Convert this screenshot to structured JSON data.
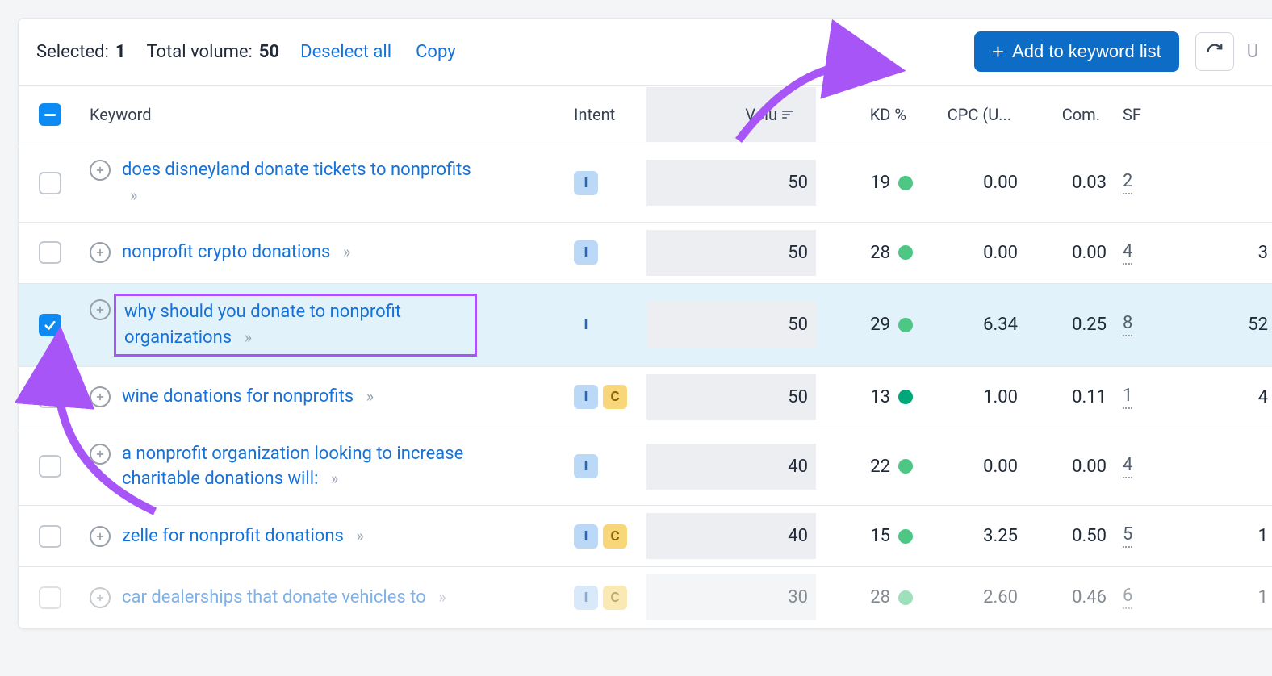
{
  "toolbar": {
    "selected_label": "Selected:",
    "selected_count": "1",
    "total_volume_label": "Total volume:",
    "total_volume": "50",
    "deselect_label": "Deselect all",
    "copy_label": "Copy",
    "add_button_label": "Add to keyword list",
    "update_fragment": "U"
  },
  "columns": {
    "keyword": "Keyword",
    "intent": "Intent",
    "volume": "Volu",
    "kd": "KD %",
    "cpc": "CPC (U...",
    "com": "Com.",
    "sf": "SF"
  },
  "rows": [
    {
      "checked": false,
      "keyword": "does disneyland donate tickets to nonprofits",
      "intents": [
        "I"
      ],
      "intent_style": "solid",
      "volume": "50",
      "kd": "19",
      "kd_color": "#4ec785",
      "cpc": "0.00",
      "com": "0.03",
      "sf": "2",
      "last": ""
    },
    {
      "checked": false,
      "keyword": "nonprofit crypto donations",
      "intents": [
        "I"
      ],
      "intent_style": "solid",
      "volume": "50",
      "kd": "28",
      "kd_color": "#4ec785",
      "cpc": "0.00",
      "com": "0.00",
      "sf": "4",
      "last": "3"
    },
    {
      "checked": true,
      "keyword": "why should you donate to nonprofit organizations",
      "intents": [
        "I"
      ],
      "intent_style": "plain",
      "volume": "50",
      "kd": "29",
      "kd_color": "#4ec785",
      "cpc": "6.34",
      "com": "0.25",
      "sf": "8",
      "last": "52",
      "highlight": true
    },
    {
      "checked": false,
      "keyword": "wine donations for nonprofits",
      "intents": [
        "I",
        "C"
      ],
      "intent_style": "solid",
      "volume": "50",
      "kd": "13",
      "kd_color": "#00a778",
      "cpc": "1.00",
      "com": "0.11",
      "sf": "1",
      "last": "4"
    },
    {
      "checked": false,
      "keyword": "a nonprofit organization looking to increase charitable donations will:",
      "intents": [
        "I"
      ],
      "intent_style": "solid",
      "volume": "40",
      "kd": "22",
      "kd_color": "#4ec785",
      "cpc": "0.00",
      "com": "0.00",
      "sf": "4",
      "last": ""
    },
    {
      "checked": false,
      "keyword": "zelle for nonprofit donations",
      "intents": [
        "I",
        "C"
      ],
      "intent_style": "solid",
      "volume": "40",
      "kd": "15",
      "kd_color": "#4ec785",
      "cpc": "3.25",
      "com": "0.50",
      "sf": "5",
      "last": "1"
    },
    {
      "checked": false,
      "keyword": "car dealerships that donate vehicles to",
      "intents": [
        "I",
        "C"
      ],
      "intent_style": "solid",
      "volume": "30",
      "kd": "28",
      "kd_color": "#4ec785",
      "cpc": "2.60",
      "com": "0.46",
      "sf": "6",
      "last": "1",
      "faded": true
    }
  ]
}
